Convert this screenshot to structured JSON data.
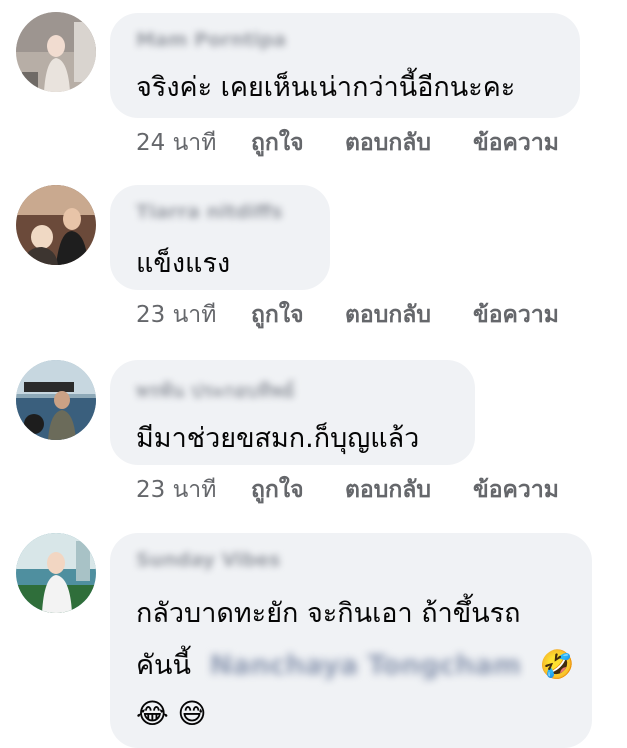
{
  "comments": [
    {
      "name": "Mam Porntipa",
      "text": "จริงค่ะ  เคยเห็นเน่ากว่านี้อีกนะคะ",
      "time": "24 นาที",
      "like": "ถูกใจ",
      "reply": "ตอบกลับ",
      "message": "ข้อความ"
    },
    {
      "name": "Tiarra nitdiffs",
      "text": "แข็งแรง",
      "time": "23 นาที",
      "like": "ถูกใจ",
      "reply": "ตอบกลับ",
      "message": "ข้อความ"
    },
    {
      "name": "พรพัน ประกอบทิพย์",
      "text": "มีมาช่วยขสมก.ก็บุญแล้ว",
      "time": "23 นาที",
      "like": "ถูกใจ",
      "reply": "ตอบกลับ",
      "message": "ข้อความ"
    },
    {
      "name": "Sunday Vibes",
      "text_line1": "กลัวบาดทะยัก จะกินเอา ถ้าขึ้นรถ",
      "text_line2": "คันนี้",
      "mention": "Nanchaya Tongcham",
      "emoji_rofl": "🤣",
      "emoji_joy": "😂",
      "emoji_sweat": "😅"
    }
  ],
  "colors": {
    "bubble": "#f0f2f5",
    "text": "#050505",
    "meta": "#65676b"
  },
  "icons": [
    "avatar-1",
    "avatar-2",
    "avatar-3",
    "avatar-4"
  ]
}
